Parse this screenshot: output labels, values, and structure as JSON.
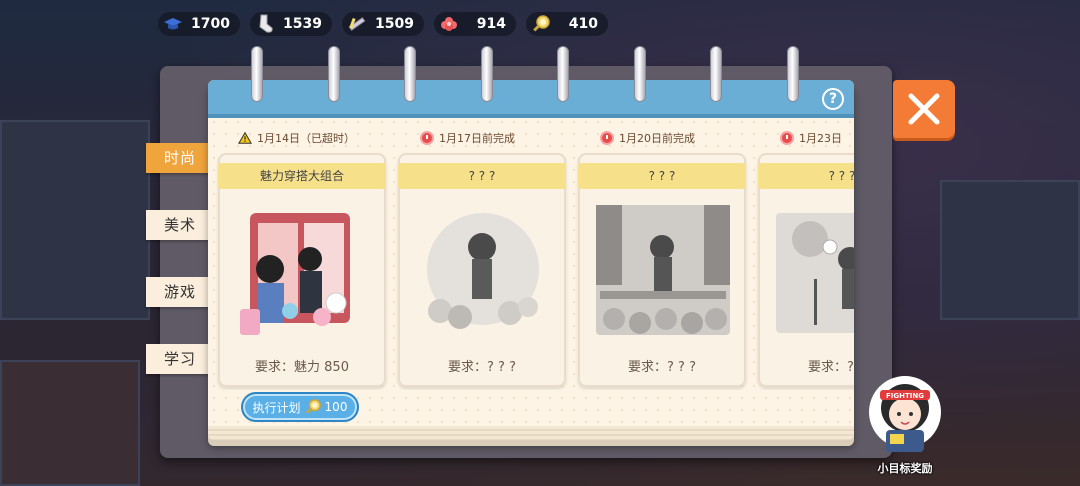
{
  "currencies": [
    {
      "icon": "graduation-cap-icon",
      "value": "1700",
      "color": "#3b6fd6"
    },
    {
      "icon": "sock-icon",
      "value": "1539",
      "color": "#e9e9ee"
    },
    {
      "icon": "pen-icon",
      "value": "1509",
      "color": "#d8c8e8"
    },
    {
      "icon": "flower-icon",
      "value": "914",
      "color": "#f26a6a"
    },
    {
      "icon": "magnifier-gear-icon",
      "value": "410",
      "color": "#f5d76e"
    }
  ],
  "help_label": "?",
  "side_tabs": [
    {
      "label": "时尚"
    },
    {
      "label": "美术"
    },
    {
      "label": "游戏"
    },
    {
      "label": "学习"
    }
  ],
  "dates": [
    {
      "text": "1月14日（已超时）"
    },
    {
      "text": "1月17日前完成"
    },
    {
      "text": "1月20日前完成"
    },
    {
      "text": "1月23日"
    }
  ],
  "cards": [
    {
      "title": "魅力穿搭大组合",
      "requirement": "要求：魅力 850"
    },
    {
      "title": "? ? ?",
      "requirement": "要求：? ? ?"
    },
    {
      "title": "? ? ?",
      "requirement": "要求：? ? ?"
    },
    {
      "title": "? ? ?",
      "requirement": "要求：? ? ?"
    }
  ],
  "execute_button": {
    "label": "执行计划",
    "cost": "100"
  },
  "mascot": {
    "label": "小目标奖励",
    "badge": "FIGHTING"
  },
  "colors": {
    "accent_orange": "#f47b35",
    "tab_active": "#f0a43c",
    "notebook_blue": "#6aaed6",
    "button_blue": "#5ab0e6"
  }
}
